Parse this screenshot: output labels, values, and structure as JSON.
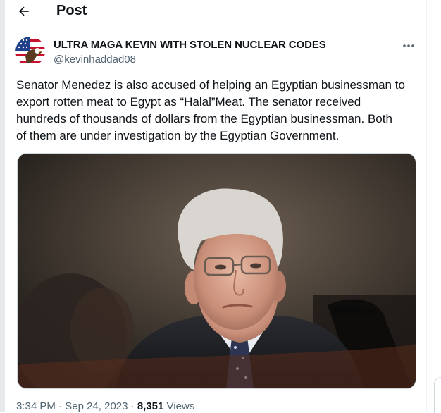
{
  "header": {
    "title": "Post",
    "back_icon": "arrow-left-icon"
  },
  "author": {
    "name": "ULTRA MAGA KEVIN WITH STOLEN NUCLEAR CODES",
    "handle": "@kevinhaddad08",
    "avatar_icon": "eagle-flag-avatar"
  },
  "more_icon": "more-horizontal-icon",
  "post": {
    "text": "Senator Menedez is also accused of helping an Egyptian businessman to\nexport rotten meat to Egypt as “Halal”Meat. The senator received\nhundreds of thousands of dollars from the Egyptian businessman.  Both\nof them are under investigation by the Egyptian Government.",
    "media_icon": "photo-senator-portrait"
  },
  "meta": {
    "time": "3:34 PM",
    "sep1": " · ",
    "date": "Sep 24, 2023",
    "sep2": " · ",
    "views_count": "8,351",
    "views_label": " Views"
  },
  "colors": {
    "text": "#0f1419",
    "secondary": "#536471",
    "border": "#cfd9de"
  }
}
